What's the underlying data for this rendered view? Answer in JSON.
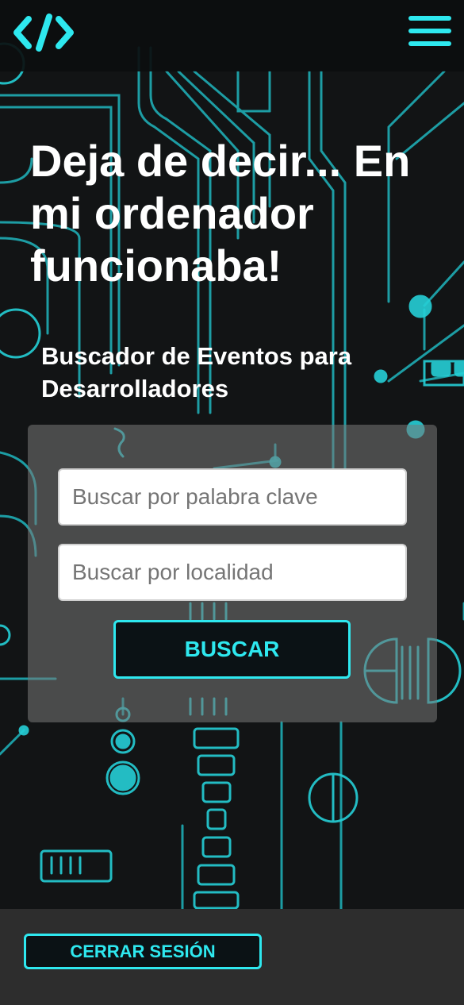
{
  "header": {
    "logo_icon": "code-brackets-icon",
    "menu_icon": "hamburger-menu-icon"
  },
  "hero": {
    "title": "Deja de decir... En mi ordenador funcionaba!"
  },
  "search": {
    "subtitle": "Buscador de Eventos para Desarrolladores",
    "keyword_placeholder": "Buscar por palabra clave",
    "keyword_value": "",
    "location_placeholder": "Buscar por localidad",
    "location_value": "",
    "button_label": "BUSCAR"
  },
  "footer": {
    "logout_label": "CERRAR SESIÓN"
  },
  "theme": {
    "accent": "#2ee8ef",
    "background": "#121415",
    "panel": "#6b6b6b",
    "footer": "#2d2d2d"
  }
}
